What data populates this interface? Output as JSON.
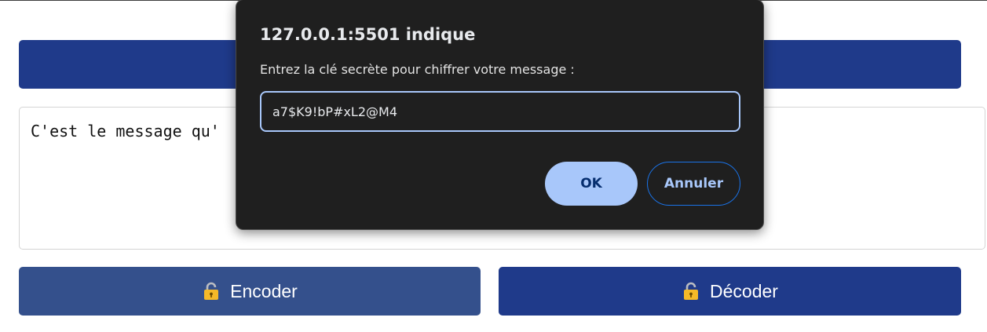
{
  "message": {
    "text": "C'est le message qu'"
  },
  "buttons": {
    "encode_label": "Encoder",
    "decode_label": "Décoder",
    "icon": "lock-icon"
  },
  "dialog": {
    "title": "127.0.0.1:5501 indique",
    "message": "Entrez la clé secrète pour chiffrer votre message :",
    "input_value": "a7$K9!bP#xL2@M4",
    "ok_label": "OK",
    "cancel_label": "Annuler"
  },
  "colors": {
    "primary_blue": "#1f3a8a",
    "encode_blue": "#34508c",
    "dialog_bg": "#1f1f1f",
    "dialog_accent": "#a8c7fa"
  }
}
